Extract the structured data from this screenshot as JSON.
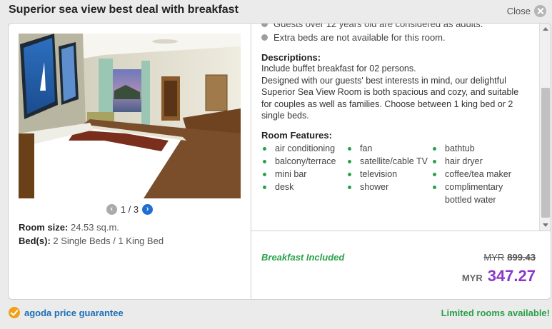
{
  "header": {
    "title": "Superior sea view best deal with breakfast",
    "close_label": "Close"
  },
  "gallery": {
    "current": 1,
    "total": 3,
    "counter_text": "1 / 3",
    "prev_glyph": "‹",
    "next_glyph": "›"
  },
  "room": {
    "size_label": "Room size:",
    "size_value": "24.53 sq.m.",
    "beds_label": "Bed(s):",
    "beds_value": "2 Single Beds / 1 King Bed"
  },
  "policies": [
    "Guests over 12 years old are considered as adults.",
    "Extra beds are not available for this room."
  ],
  "descriptions": {
    "title": "Descriptions:",
    "line1": "Include buffet breakfast for 02 persons.",
    "body": "Designed with our guests' best interests in mind, our delightful Superior Sea View Room is both spacious and cozy, and suitable for couples as well as families. Choose between 1 king bed or 2 single beds."
  },
  "features": {
    "title": "Room Features:",
    "col1": [
      "air conditioning",
      "balcony/terrace",
      "mini bar",
      "desk"
    ],
    "col2": [
      "fan",
      "satellite/cable TV",
      "television",
      "shower"
    ],
    "col3": [
      "bathtub",
      "hair dryer",
      "coffee/tea maker",
      "complimentary bottled water"
    ]
  },
  "pricing": {
    "breakfast_label": "Breakfast Included",
    "old_currency": "MYR",
    "old_price": "899.43",
    "currency": "MYR",
    "price": "347.27"
  },
  "footer": {
    "guarantee": "agoda price guarantee",
    "limited": "Limited rooms available!"
  },
  "colors": {
    "accent_green": "#2aa14a",
    "price_purple": "#8a3ac8",
    "link_blue": "#1a6fb8",
    "pager_blue": "#1f6fd0"
  },
  "icons": [
    "close-icon",
    "prev-arrow-icon",
    "next-arrow-icon",
    "check-badge-icon"
  ]
}
